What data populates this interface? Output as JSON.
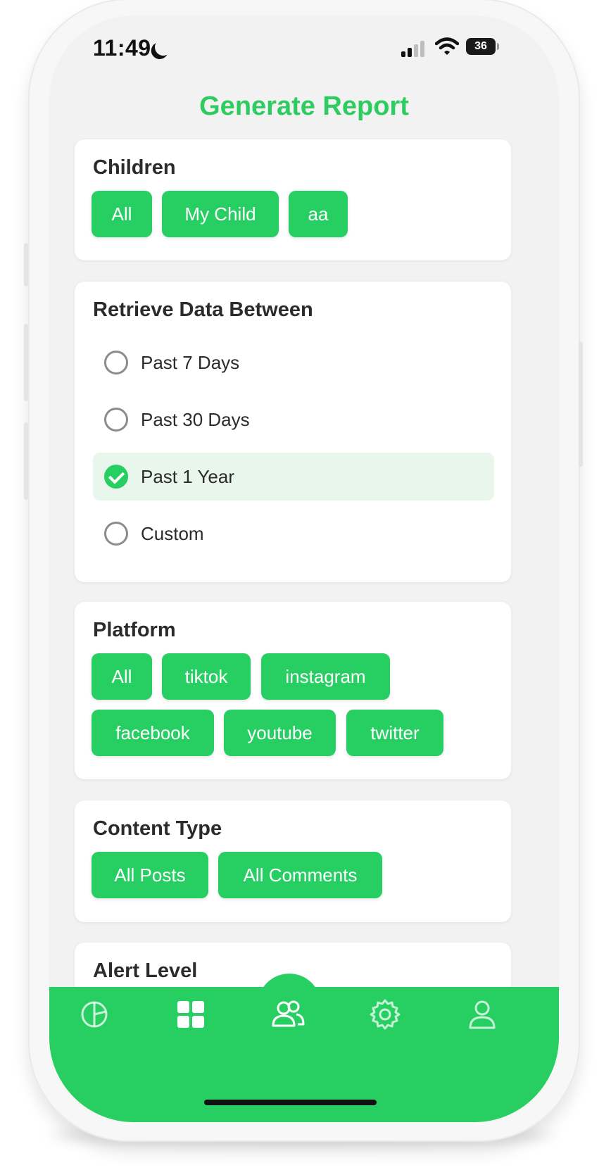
{
  "status_bar": {
    "time": "11:49",
    "battery": "36"
  },
  "header": {
    "title": "Generate Report"
  },
  "children": {
    "title": "Children",
    "options": [
      "All",
      "My Child",
      "aa"
    ]
  },
  "date_range": {
    "title": "Retrieve Data Between",
    "options": [
      {
        "label": "Past 7 Days",
        "selected": false
      },
      {
        "label": "Past 30 Days",
        "selected": false
      },
      {
        "label": "Past 1 Year",
        "selected": true
      },
      {
        "label": "Custom",
        "selected": false
      }
    ]
  },
  "platform": {
    "title": "Platform",
    "options": [
      "All",
      "tiktok",
      "instagram",
      "facebook",
      "youtube",
      "twitter"
    ]
  },
  "content_type": {
    "title": "Content Type",
    "options": [
      "All Posts",
      "All Comments"
    ]
  },
  "alert_level": {
    "title": "Alert Level"
  },
  "tab_bar": {
    "active": "family",
    "tabs": [
      {
        "id": "analytics",
        "icon": "pie-chart-icon"
      },
      {
        "id": "dashboard",
        "icon": "grid-icon"
      },
      {
        "id": "family",
        "icon": "users-icon"
      },
      {
        "id": "settings",
        "icon": "gear-icon"
      },
      {
        "id": "profile",
        "icon": "user-icon"
      }
    ]
  },
  "colors": {
    "accent": "#27cf63",
    "title": "#2ecc60",
    "selected_row": "#e9f6ec"
  }
}
